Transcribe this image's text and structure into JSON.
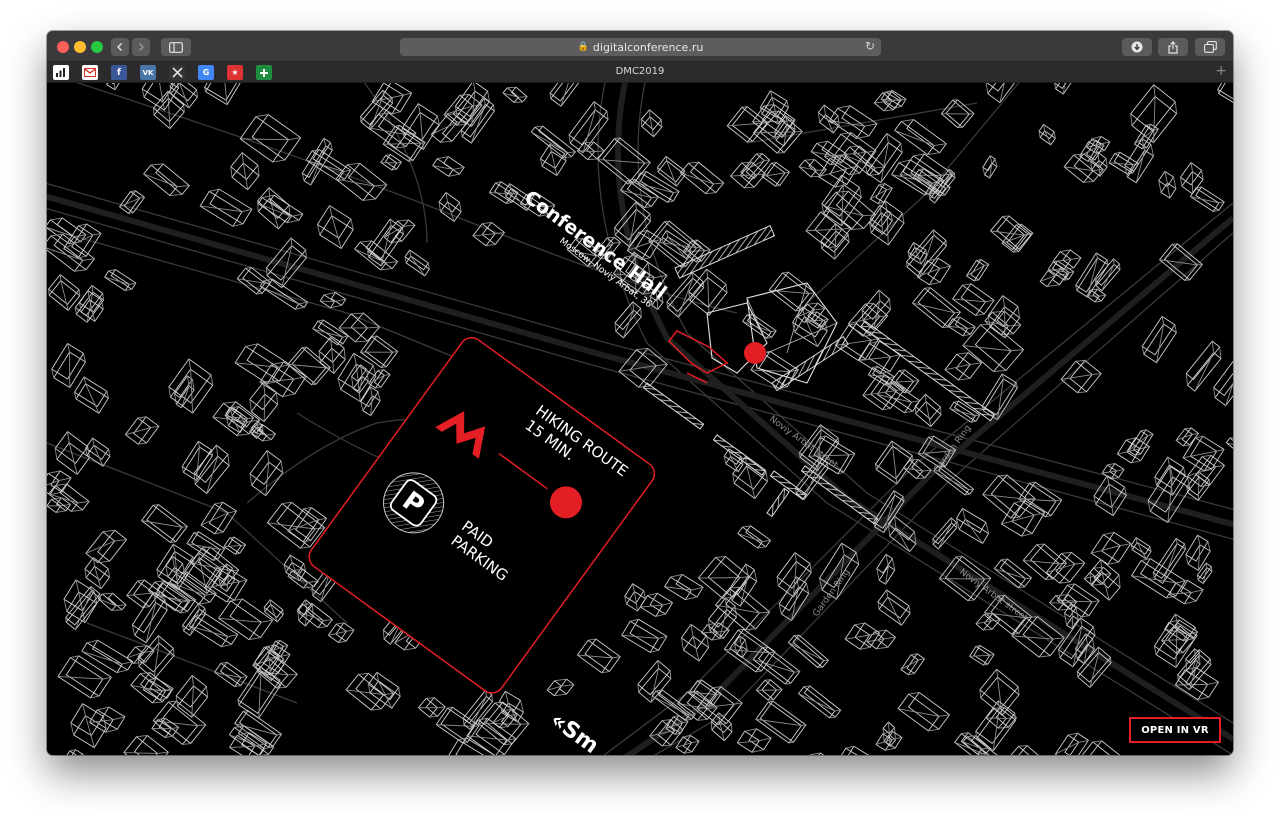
{
  "browser": {
    "url": "digitalconference.ru",
    "tab_title": "DMC2019",
    "favicons": [
      "stats-icon",
      "gmail-icon",
      "facebook-icon",
      "vk-icon",
      "x-icon",
      "translate-icon",
      "bookmark-icon",
      "plus-cross-icon"
    ]
  },
  "map": {
    "venue_title": "Conference Hall",
    "venue_address": "Moscow, Noviy Arbat, 36",
    "street_labels": [
      "Noviy Arbat street",
      "Garden Ring",
      "Garden Ring",
      "Noviy Arbat street"
    ],
    "partial_label": "«Sm"
  },
  "info_card": {
    "route_line1": "HIKING ROUTE",
    "route_line2": "15 MIN.",
    "parking_line1": "PAID",
    "parking_line2": "PARKING",
    "parking_letter": "P"
  },
  "vr_button": {
    "label": "OPEN IN VR"
  },
  "colors": {
    "accent": "#e31e24",
    "map_bg": "#000000",
    "lines": "#bfbfbf"
  }
}
